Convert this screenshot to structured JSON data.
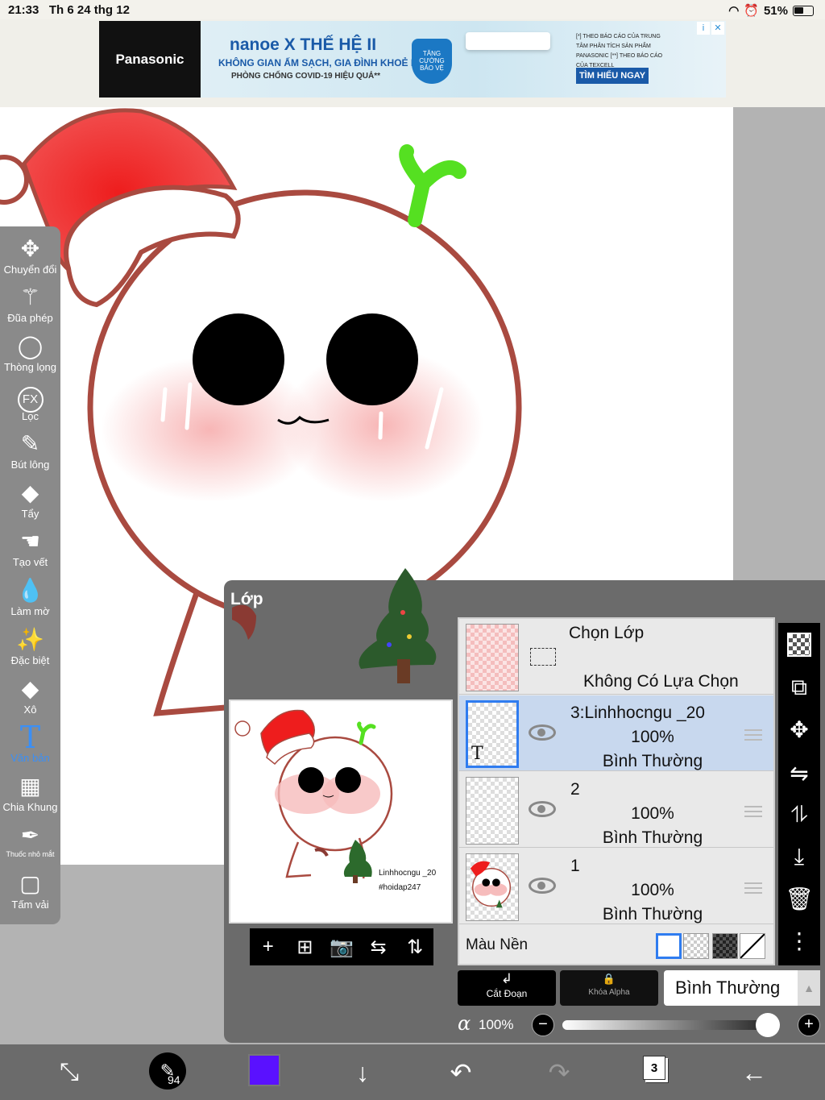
{
  "status_bar": {
    "time": "21:33",
    "date": "Th 6 24 thg 12",
    "battery": "51%"
  },
  "ad": {
    "brand": "Panasonic",
    "logo_text": "nanoe X THẾ HỆ II",
    "line1": "KHÔNG GIAN ẤM SẠCH, GIA ĐÌNH KHOẺ MẠNH",
    "line2": "PHÒNG CHỐNG COVID-19 HIỆU QUẢ**",
    "shield_text": "TĂNG CƯỜNG BẢO VỆ",
    "fine_print": "[*] THEO BÁO CÁO CỦA TRUNG TÂM PHÂN TÍCH SẢN PHẨM PANASONIC [**] THEO BÁO CÁO CỦA TEXCELL",
    "cta": "TÌM HIỂU NGAY",
    "info_glyph": "i",
    "close_glyph": "✕"
  },
  "toolbar": {
    "tools": [
      {
        "id": "transform",
        "label": "Chuyển đổi",
        "icon": "move-icon",
        "glyph": "✥"
      },
      {
        "id": "magic-wand",
        "label": "Đũa phép",
        "icon": "magic-wand-icon",
        "glyph": "⚚"
      },
      {
        "id": "lasso",
        "label": "Thòng lọng",
        "icon": "lasso-icon",
        "glyph": "◯"
      },
      {
        "id": "filter",
        "label": "Lọc",
        "icon": "fx-icon",
        "glyph": "FX"
      },
      {
        "id": "brush",
        "label": "Bút lông",
        "icon": "brush-icon",
        "glyph": "✎"
      },
      {
        "id": "eraser",
        "label": "Tẩy",
        "icon": "eraser-icon",
        "glyph": "◆"
      },
      {
        "id": "smudge",
        "label": "Tạo vết",
        "icon": "smudge-icon",
        "glyph": "☚"
      },
      {
        "id": "blur",
        "label": "Làm mờ",
        "icon": "blur-drop-icon",
        "glyph": "💧"
      },
      {
        "id": "special",
        "label": "Đặc biệt",
        "icon": "special-icon",
        "glyph": "✨"
      },
      {
        "id": "fill",
        "label": "Xô",
        "icon": "bucket-icon",
        "glyph": "◆"
      },
      {
        "id": "text",
        "label": "Văn bản",
        "icon": "text-t-icon",
        "glyph": "T"
      },
      {
        "id": "frame",
        "label": "Chia Khung",
        "icon": "frame-divider-icon",
        "glyph": "▦"
      },
      {
        "id": "eyedropper",
        "label": "Thuốc nhỏ mắt",
        "icon": "eyedropper-icon",
        "glyph": "✒"
      },
      {
        "id": "canvas",
        "label": "Tấm vải",
        "icon": "canvas-icon",
        "glyph": "▢"
      }
    ],
    "active": "text"
  },
  "layer_panel": {
    "title": "Lớp",
    "preview_caption_line1": "Linhhocngu _20",
    "preview_caption_line2": "#hoidap247",
    "preview_tools": [
      {
        "icon": "add-layer-icon",
        "glyph": "+"
      },
      {
        "icon": "add-layer-box-icon",
        "glyph": "⊞"
      },
      {
        "icon": "camera-icon",
        "glyph": "📷"
      },
      {
        "icon": "flip-horizontal-icon",
        "glyph": "⇆"
      },
      {
        "icon": "flip-vertical-icon",
        "glyph": "⇅"
      }
    ],
    "selection": {
      "title": "Chọn Lớp",
      "subtitle": "Không Có Lựa Chọn"
    },
    "layers": [
      {
        "name": "3:Linhhocngu _20",
        "opacity": "100%",
        "mode": "Bình Thường",
        "selected": true,
        "thumb_glyph": "T"
      },
      {
        "name": "2",
        "opacity": "100%",
        "mode": "Bình Thường",
        "selected": false
      },
      {
        "name": "1",
        "opacity": "100%",
        "mode": "Bình Thường",
        "selected": false
      }
    ],
    "background_label": "Màu Nền",
    "clipping_label": "Cắt Đoạn",
    "clipping_glyph": "↲",
    "alpha_lock_label": "Khóa Alpha",
    "alpha_lock_glyph": "🔒",
    "blend_mode": "Bình Thường",
    "blend_arrow": "▲",
    "alpha_symbol": "α",
    "opacity_value": "100%",
    "opacity_level": 1.0,
    "minus": "−",
    "plus": "+"
  },
  "right_toolbar": [
    {
      "icon": "checker-transparency-icon",
      "glyph": ""
    },
    {
      "icon": "layer-transform-icon",
      "glyph": "⧉"
    },
    {
      "icon": "move-layer-icon",
      "glyph": "✥"
    },
    {
      "icon": "flip-horizontal-icon",
      "glyph": "⇋"
    },
    {
      "icon": "flip-vertical-icon",
      "glyph": "⥮"
    },
    {
      "icon": "merge-down-icon",
      "glyph": "⤓"
    },
    {
      "icon": "trash-icon",
      "glyph": "🗑"
    },
    {
      "icon": "more-vertical-icon",
      "glyph": "⋮"
    }
  ],
  "bottom_bar": {
    "transform_glyph": "⤡",
    "brush_glyph": "✎",
    "brush_size": "94",
    "current_color": "#5a11ff",
    "down_glyph": "↓",
    "undo_glyph": "↶",
    "redo_glyph": "↷",
    "layers_count": "3",
    "back_glyph": "←"
  },
  "colors": {
    "active_tool": "#3b8ff5",
    "selected_layer": "#c8d8ee",
    "outline": "#a94a40",
    "hat_red": "#ee1d1d"
  }
}
